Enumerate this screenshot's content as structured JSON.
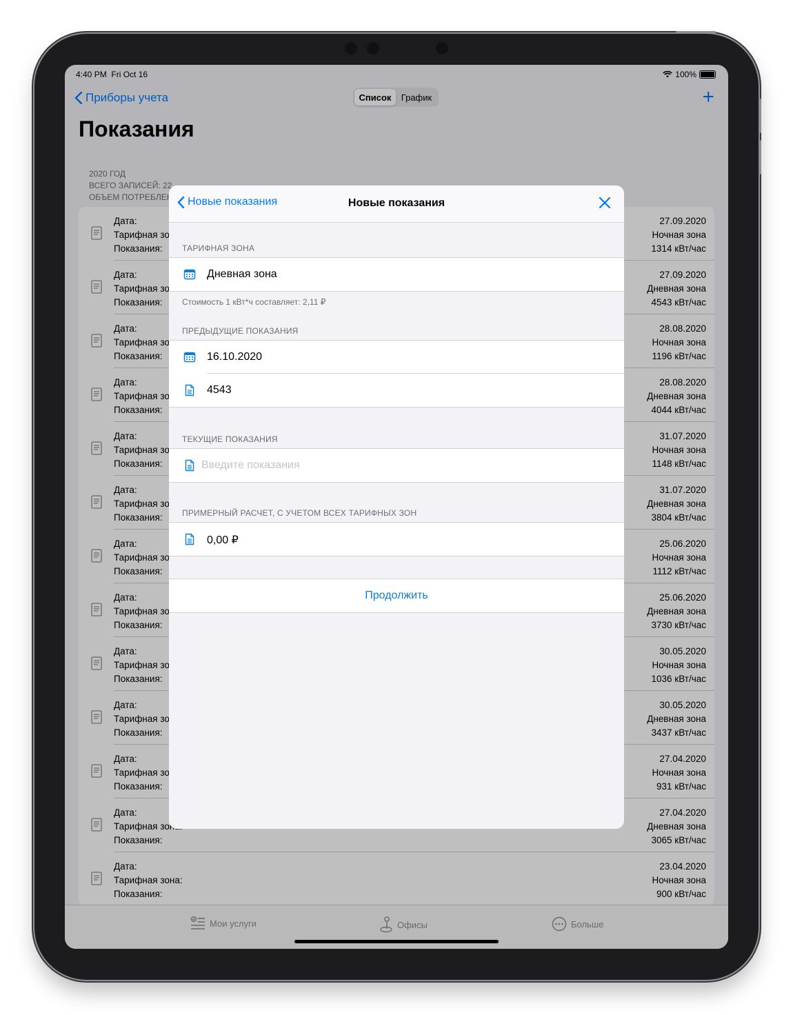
{
  "status": {
    "time": "4:40 PM",
    "date": "Fri Oct 16",
    "battery": "100%"
  },
  "nav": {
    "back_label": "Приборы учета",
    "seg_list": "Список",
    "seg_chart": "График",
    "add_label": "+"
  },
  "page_title": "Показания",
  "summary": {
    "year": "2020 ГОД",
    "records": "ВСЕГО ЗАПИСЕЙ: 22",
    "volume": "ОБЪЕМ ПОТРЕБЛЕН"
  },
  "row_labels": {
    "date": "Дата:",
    "zone": "Тарифная зона:",
    "reading": "Показания:"
  },
  "readings": [
    {
      "date": "27.09.2020",
      "zone": "Ночная зона",
      "value": "1314 кВт/час"
    },
    {
      "date": "27.09.2020",
      "zone": "Дневная зона",
      "value": "4543 кВт/час"
    },
    {
      "date": "28.08.2020",
      "zone": "Ночная зона",
      "value": "1196 кВт/час"
    },
    {
      "date": "28.08.2020",
      "zone": "Дневная зона",
      "value": "4044 кВт/час"
    },
    {
      "date": "31.07.2020",
      "zone": "Ночная зона",
      "value": "1148 кВт/час"
    },
    {
      "date": "31.07.2020",
      "zone": "Дневная зона",
      "value": "3804 кВт/час"
    },
    {
      "date": "25.06.2020",
      "zone": "Ночная зона",
      "value": "1112 кВт/час"
    },
    {
      "date": "25.06.2020",
      "zone": "Дневная зона",
      "value": "3730 кВт/час"
    },
    {
      "date": "30.05.2020",
      "zone": "Ночная зона",
      "value": "1036 кВт/час"
    },
    {
      "date": "30.05.2020",
      "zone": "Дневная зона",
      "value": "3437 кВт/час"
    },
    {
      "date": "27.04.2020",
      "zone": "Ночная зона",
      "value": "931 кВт/час"
    },
    {
      "date": "27.04.2020",
      "zone": "Дневная зона",
      "value": "3065 кВт/час"
    },
    {
      "date": "23.04.2020",
      "zone": "Ночная зона",
      "value": "900 кВт/час"
    }
  ],
  "tabs": [
    {
      "label": "Мои услуги",
      "icon": "services-icon"
    },
    {
      "label": "Офисы",
      "icon": "map-pin-icon"
    },
    {
      "label": "Больше",
      "icon": "more-icon"
    }
  ],
  "modal": {
    "back_label": "Новые показания",
    "title": "Новые показания",
    "section_zone": "ТАРИФНАЯ ЗОНА",
    "zone_value": "Дневная зона",
    "zone_footer": "Стоимость 1 кВт*ч составляет: 2,11 ₽",
    "section_previous": "ПРЕДЫДУЩИЕ ПОКАЗАНИЯ",
    "previous_date": "16.10.2020",
    "previous_value": "4543",
    "section_current": "ТЕКУЩИЕ ПОКАЗАНИЯ",
    "current_placeholder": "Введите показания",
    "section_estimate": "ПРИМЕРНЫЙ РАСЧЕТ, С УЧЕТОМ ВСЕХ ТАРИФНЫХ ЗОН",
    "estimate_value": "0,00 ₽",
    "continue_label": "Продолжить"
  },
  "colors": {
    "accent": "#007aff",
    "continue": "#0a7fd8"
  }
}
